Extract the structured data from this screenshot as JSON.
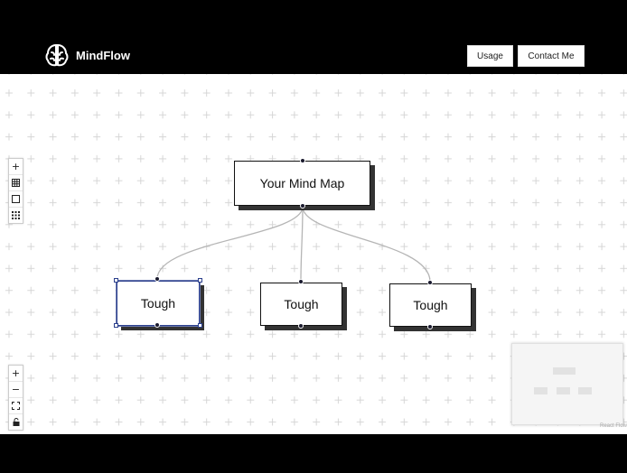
{
  "header": {
    "brand_name": "MindFlow",
    "logo_icon": "brain-icon",
    "nav": [
      {
        "label": "Usage"
      },
      {
        "label": "Contact Me"
      }
    ]
  },
  "mindmap": {
    "root": {
      "label": "Your Mind Map"
    },
    "children": [
      {
        "label": "Tough",
        "selected": true
      },
      {
        "label": "Tough",
        "selected": false
      },
      {
        "label": "Tough",
        "selected": false
      }
    ]
  },
  "controls": {
    "top_group": [
      "plus-icon",
      "grid-icon",
      "square-icon",
      "dots-grid-icon"
    ],
    "bottom_group": [
      "zoom-in-icon",
      "zoom-out-icon",
      "fit-view-icon",
      "lock-icon"
    ]
  },
  "attribution": "React Flow",
  "colors": {
    "header_bg": "#000000",
    "selection": "#2b3f8c",
    "edge": "#b5b5b5",
    "grid_cross": "#d6d6d6"
  }
}
